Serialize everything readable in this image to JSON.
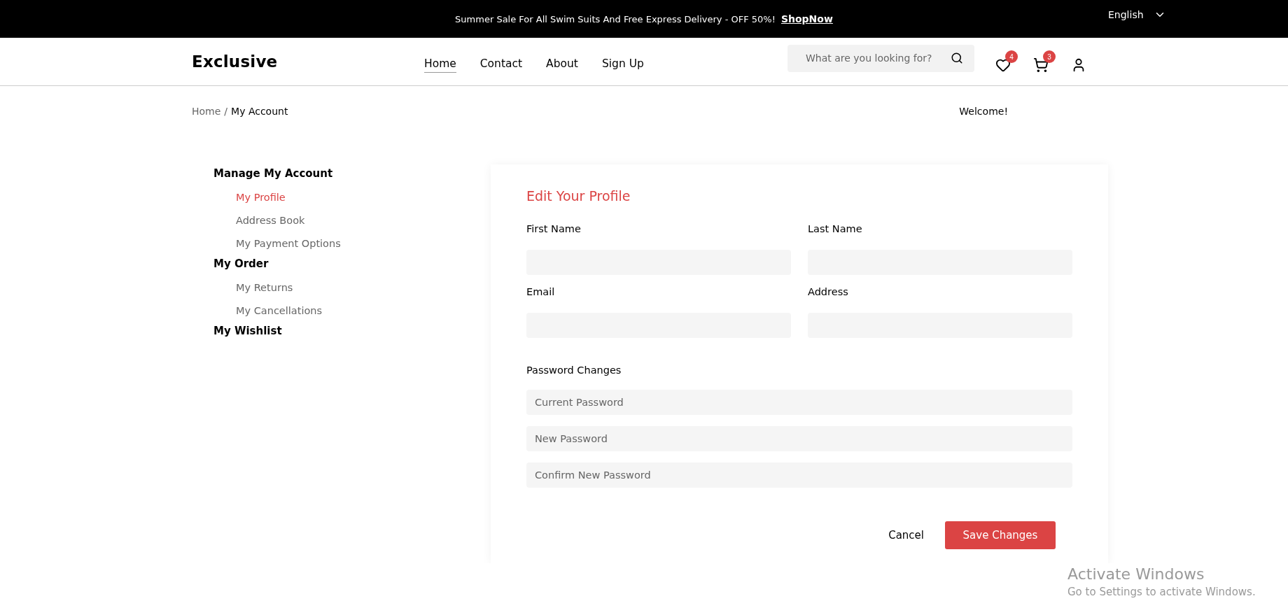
{
  "announcement": {
    "text": "Summer Sale For All Swim Suits And Free Express Delivery - OFF 50%!",
    "link": "ShopNow",
    "language": "English"
  },
  "header": {
    "logo": "Exclusive",
    "nav": [
      {
        "label": "Home",
        "selected": true
      },
      {
        "label": "Contact",
        "selected": false
      },
      {
        "label": "About",
        "selected": false
      },
      {
        "label": "Sign Up",
        "selected": false
      }
    ],
    "search": {
      "placeholder": "What are you looking for?"
    },
    "wishlist_count": "4",
    "cart_count": "3"
  },
  "breadcrumb": {
    "parent": "Home",
    "separator": "/",
    "current": "My Account"
  },
  "welcome": "Welcome!",
  "sidebar": [
    {
      "label": "Manage My Account",
      "children": [
        {
          "label": "My Profile",
          "selected": true
        },
        {
          "label": "Address Book",
          "selected": false
        },
        {
          "label": "My Payment Options",
          "selected": false
        }
      ]
    },
    {
      "label": "My Order",
      "children": [
        {
          "label": "My Returns",
          "selected": false
        },
        {
          "label": "My Cancellations",
          "selected": false
        }
      ]
    },
    {
      "label": "My Wishlist"
    }
  ],
  "profile": {
    "title": "Edit Your Profile",
    "fields": [
      {
        "label": "First Name"
      },
      {
        "label": "Last Name"
      },
      {
        "label": "Email"
      },
      {
        "label": "Address"
      }
    ],
    "password_heading": "Password Changes",
    "password_fields": [
      {
        "placeholder": "Current Password"
      },
      {
        "placeholder": "New Password"
      },
      {
        "placeholder": "Confirm New Password"
      }
    ],
    "cancel": "Cancel",
    "save": "Save Changes"
  },
  "os_notice": {
    "title": "Activate Windows",
    "text": "Go to Settings to activate Windows."
  }
}
